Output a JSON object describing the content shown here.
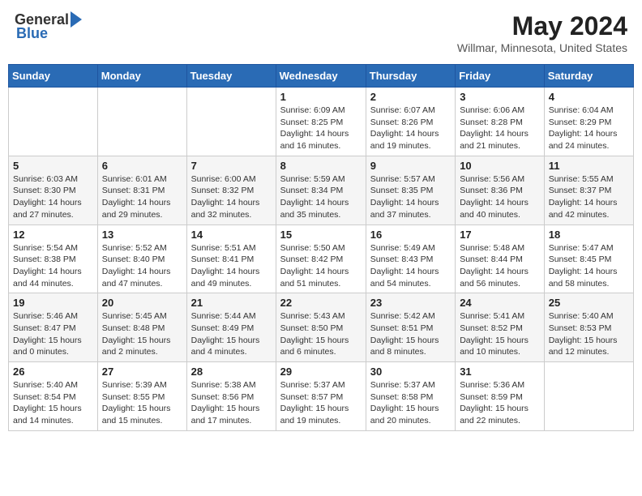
{
  "header": {
    "logo_general": "General",
    "logo_blue": "Blue",
    "month_title": "May 2024",
    "location": "Willmar, Minnesota, United States"
  },
  "days_of_week": [
    "Sunday",
    "Monday",
    "Tuesday",
    "Wednesday",
    "Thursday",
    "Friday",
    "Saturday"
  ],
  "weeks": [
    [
      {
        "day": "",
        "info": ""
      },
      {
        "day": "",
        "info": ""
      },
      {
        "day": "",
        "info": ""
      },
      {
        "day": "1",
        "info": "Sunrise: 6:09 AM\nSunset: 8:25 PM\nDaylight: 14 hours\nand 16 minutes."
      },
      {
        "day": "2",
        "info": "Sunrise: 6:07 AM\nSunset: 8:26 PM\nDaylight: 14 hours\nand 19 minutes."
      },
      {
        "day": "3",
        "info": "Sunrise: 6:06 AM\nSunset: 8:28 PM\nDaylight: 14 hours\nand 21 minutes."
      },
      {
        "day": "4",
        "info": "Sunrise: 6:04 AM\nSunset: 8:29 PM\nDaylight: 14 hours\nand 24 minutes."
      }
    ],
    [
      {
        "day": "5",
        "info": "Sunrise: 6:03 AM\nSunset: 8:30 PM\nDaylight: 14 hours\nand 27 minutes."
      },
      {
        "day": "6",
        "info": "Sunrise: 6:01 AM\nSunset: 8:31 PM\nDaylight: 14 hours\nand 29 minutes."
      },
      {
        "day": "7",
        "info": "Sunrise: 6:00 AM\nSunset: 8:32 PM\nDaylight: 14 hours\nand 32 minutes."
      },
      {
        "day": "8",
        "info": "Sunrise: 5:59 AM\nSunset: 8:34 PM\nDaylight: 14 hours\nand 35 minutes."
      },
      {
        "day": "9",
        "info": "Sunrise: 5:57 AM\nSunset: 8:35 PM\nDaylight: 14 hours\nand 37 minutes."
      },
      {
        "day": "10",
        "info": "Sunrise: 5:56 AM\nSunset: 8:36 PM\nDaylight: 14 hours\nand 40 minutes."
      },
      {
        "day": "11",
        "info": "Sunrise: 5:55 AM\nSunset: 8:37 PM\nDaylight: 14 hours\nand 42 minutes."
      }
    ],
    [
      {
        "day": "12",
        "info": "Sunrise: 5:54 AM\nSunset: 8:38 PM\nDaylight: 14 hours\nand 44 minutes."
      },
      {
        "day": "13",
        "info": "Sunrise: 5:52 AM\nSunset: 8:40 PM\nDaylight: 14 hours\nand 47 minutes."
      },
      {
        "day": "14",
        "info": "Sunrise: 5:51 AM\nSunset: 8:41 PM\nDaylight: 14 hours\nand 49 minutes."
      },
      {
        "day": "15",
        "info": "Sunrise: 5:50 AM\nSunset: 8:42 PM\nDaylight: 14 hours\nand 51 minutes."
      },
      {
        "day": "16",
        "info": "Sunrise: 5:49 AM\nSunset: 8:43 PM\nDaylight: 14 hours\nand 54 minutes."
      },
      {
        "day": "17",
        "info": "Sunrise: 5:48 AM\nSunset: 8:44 PM\nDaylight: 14 hours\nand 56 minutes."
      },
      {
        "day": "18",
        "info": "Sunrise: 5:47 AM\nSunset: 8:45 PM\nDaylight: 14 hours\nand 58 minutes."
      }
    ],
    [
      {
        "day": "19",
        "info": "Sunrise: 5:46 AM\nSunset: 8:47 PM\nDaylight: 15 hours\nand 0 minutes."
      },
      {
        "day": "20",
        "info": "Sunrise: 5:45 AM\nSunset: 8:48 PM\nDaylight: 15 hours\nand 2 minutes."
      },
      {
        "day": "21",
        "info": "Sunrise: 5:44 AM\nSunset: 8:49 PM\nDaylight: 15 hours\nand 4 minutes."
      },
      {
        "day": "22",
        "info": "Sunrise: 5:43 AM\nSunset: 8:50 PM\nDaylight: 15 hours\nand 6 minutes."
      },
      {
        "day": "23",
        "info": "Sunrise: 5:42 AM\nSunset: 8:51 PM\nDaylight: 15 hours\nand 8 minutes."
      },
      {
        "day": "24",
        "info": "Sunrise: 5:41 AM\nSunset: 8:52 PM\nDaylight: 15 hours\nand 10 minutes."
      },
      {
        "day": "25",
        "info": "Sunrise: 5:40 AM\nSunset: 8:53 PM\nDaylight: 15 hours\nand 12 minutes."
      }
    ],
    [
      {
        "day": "26",
        "info": "Sunrise: 5:40 AM\nSunset: 8:54 PM\nDaylight: 15 hours\nand 14 minutes."
      },
      {
        "day": "27",
        "info": "Sunrise: 5:39 AM\nSunset: 8:55 PM\nDaylight: 15 hours\nand 15 minutes."
      },
      {
        "day": "28",
        "info": "Sunrise: 5:38 AM\nSunset: 8:56 PM\nDaylight: 15 hours\nand 17 minutes."
      },
      {
        "day": "29",
        "info": "Sunrise: 5:37 AM\nSunset: 8:57 PM\nDaylight: 15 hours\nand 19 minutes."
      },
      {
        "day": "30",
        "info": "Sunrise: 5:37 AM\nSunset: 8:58 PM\nDaylight: 15 hours\nand 20 minutes."
      },
      {
        "day": "31",
        "info": "Sunrise: 5:36 AM\nSunset: 8:59 PM\nDaylight: 15 hours\nand 22 minutes."
      },
      {
        "day": "",
        "info": ""
      }
    ]
  ]
}
